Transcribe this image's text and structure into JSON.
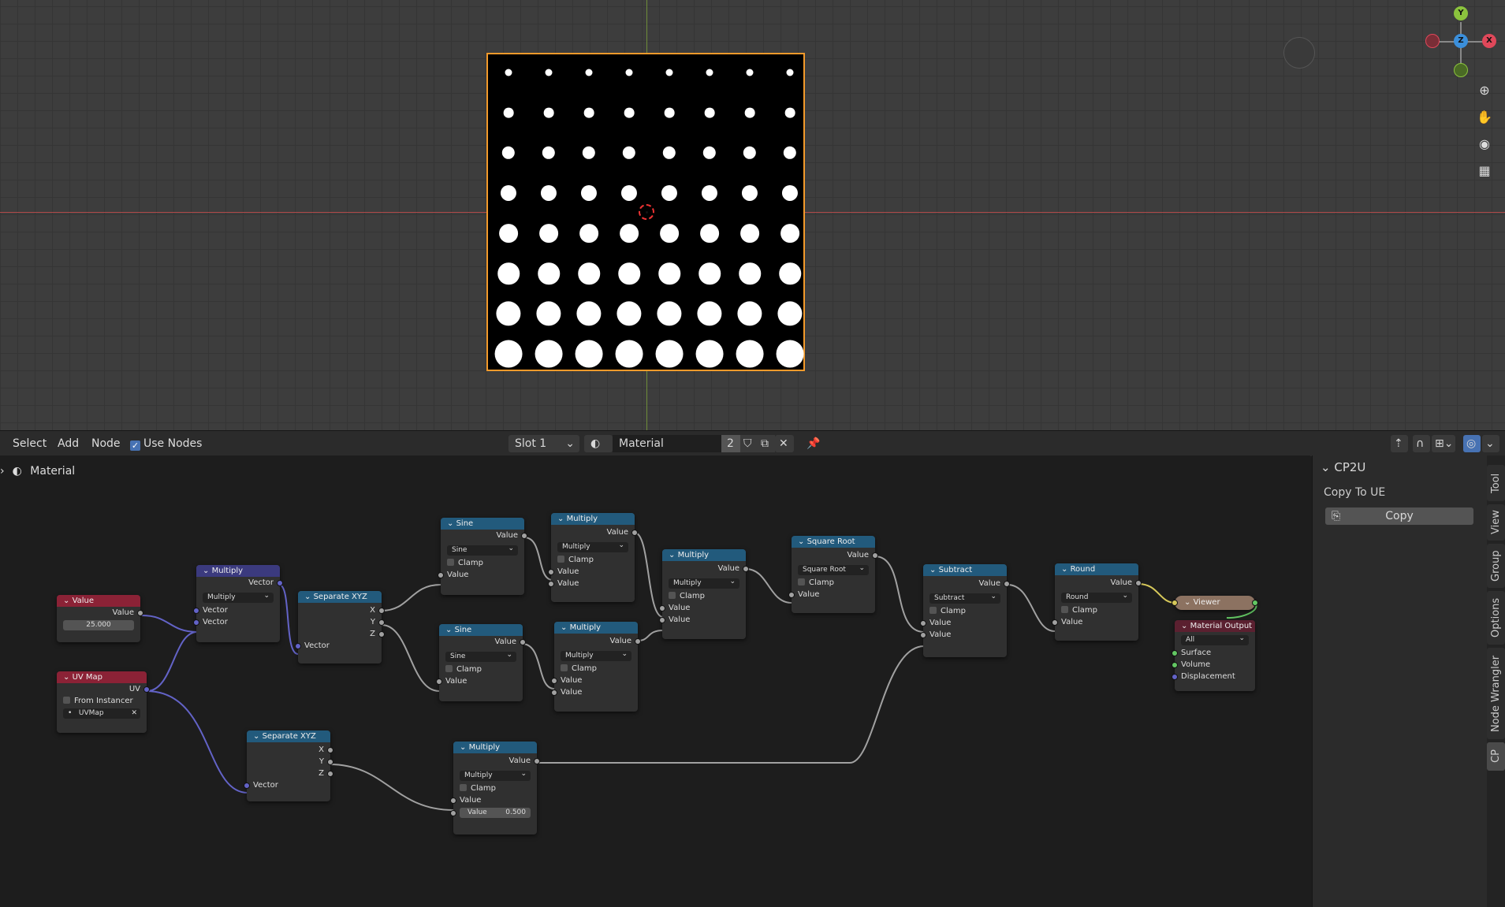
{
  "viewport": {
    "gizmo": {
      "x": "X",
      "y": "Y",
      "z": "Z"
    },
    "tool_icons": [
      "zoom-icon",
      "hand-icon",
      "camera-icon",
      "grid-icon"
    ]
  },
  "node_editor_header": {
    "menu": [
      "Select",
      "Add",
      "Node"
    ],
    "use_nodes_label": "Use Nodes",
    "slot": "Slot 1",
    "material_name": "Material",
    "user_count": "2"
  },
  "breadcrumb": "Material",
  "nodes": {
    "value": {
      "title": "Value",
      "out": "Value",
      "field": "25.000"
    },
    "uvmap": {
      "title": "UV Map",
      "out": "UV",
      "from_instancer": "From Instancer",
      "map": "UVMap"
    },
    "multiply1": {
      "title": "Multiply",
      "out": "Vector",
      "op": "Multiply",
      "in1": "Vector",
      "in2": "Vector"
    },
    "sepxyz1": {
      "title": "Separate XYZ",
      "x": "X",
      "y": "Y",
      "z": "Z",
      "in": "Vector"
    },
    "sepxyz2": {
      "title": "Separate XYZ",
      "x": "X",
      "y": "Y",
      "z": "Z",
      "in": "Vector"
    },
    "sine1": {
      "title": "Sine",
      "out": "Value",
      "op": "Sine",
      "clamp": "Clamp",
      "in": "Value"
    },
    "sine2": {
      "title": "Sine",
      "out": "Value",
      "op": "Sine",
      "clamp": "Clamp",
      "in": "Value"
    },
    "multiply2": {
      "title": "Multiply",
      "out": "Value",
      "op": "Multiply",
      "clamp": "Clamp",
      "in1": "Value",
      "in2": "Value"
    },
    "multiply3": {
      "title": "Multiply",
      "out": "Value",
      "op": "Multiply",
      "clamp": "Clamp",
      "in1": "Value",
      "in2": "Value"
    },
    "multiply4": {
      "title": "Multiply",
      "out": "Value",
      "op": "Multiply",
      "clamp": "Clamp",
      "in1": "Value",
      "in2": "Value"
    },
    "multiply5": {
      "title": "Multiply",
      "out": "Value",
      "op": "Multiply",
      "clamp": "Clamp",
      "in1": "Value",
      "in2_label": "Value",
      "in2_value": "0.500"
    },
    "sqrt": {
      "title": "Square Root",
      "out": "Value",
      "op": "Square Root",
      "clamp": "Clamp",
      "in": "Value"
    },
    "subtract": {
      "title": "Subtract",
      "out": "Value",
      "op": "Subtract",
      "clamp": "Clamp",
      "in1": "Value",
      "in2": "Value"
    },
    "round": {
      "title": "Round",
      "out": "Value",
      "op": "Round",
      "clamp": "Clamp",
      "in": "Value"
    },
    "viewer": {
      "title": "Viewer"
    },
    "matout": {
      "title": "Material Output",
      "target": "All",
      "surface": "Surface",
      "volume": "Volume",
      "displacement": "Displacement"
    }
  },
  "side_panel": {
    "title": "CP2U",
    "subtitle": "Copy To UE",
    "button": "Copy",
    "tabs": [
      "Tool",
      "View",
      "Group",
      "Options",
      "Node Wrangler",
      "CP"
    ]
  },
  "colors": {
    "accent": "#4772b3",
    "selection": "#f39a2b",
    "math_node": "#225a7c",
    "vector_node": "#3b3a7e",
    "input_node": "#8b2236"
  }
}
